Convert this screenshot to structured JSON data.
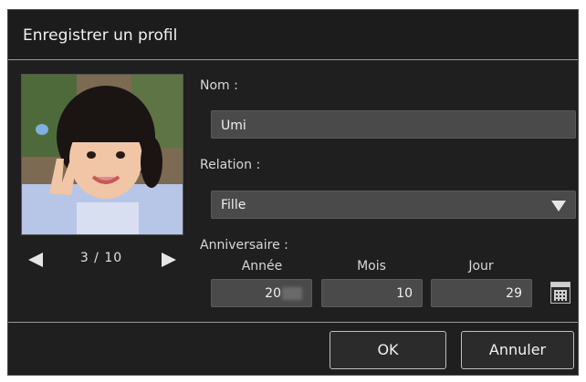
{
  "dialog": {
    "title": "Enregistrer un profil"
  },
  "photo": {
    "description_icon": "profile-photo",
    "counter": "3 / 10"
  },
  "form": {
    "name_label": "Nom :",
    "name_value": "Umi",
    "relation_label": "Relation :",
    "relation_value": "Fille",
    "birthday_label": "Anniversaire :",
    "year_label": "Année",
    "month_label": "Mois",
    "day_label": "Jour",
    "year_value": "20",
    "month_value": "10",
    "day_value": "29"
  },
  "buttons": {
    "ok": "OK",
    "cancel": "Annuler"
  },
  "colors": {
    "dialog_bg": "#1f1f1f",
    "field_bg": "#4a4a4a",
    "text": "#e8e8e8"
  }
}
